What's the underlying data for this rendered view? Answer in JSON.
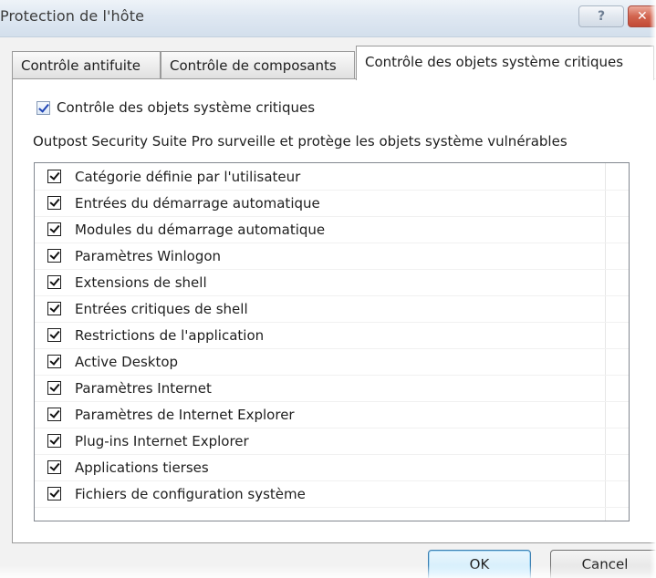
{
  "window": {
    "title": "Protection de l'hôte",
    "help_label": "?",
    "close_label": "✕"
  },
  "tabs": [
    {
      "label": "Contrôle antifuite",
      "selected": false
    },
    {
      "label": "Contrôle de composants",
      "selected": false
    },
    {
      "label": "Contrôle des objets système critiques",
      "selected": true
    }
  ],
  "panel": {
    "main_checkbox": {
      "label": "Contrôle des objets système critiques",
      "checked": true
    },
    "description": "Outpost Security Suite Pro surveille et protège les objets système vulnérables",
    "items": [
      {
        "label": "Catégorie définie par l'utilisateur",
        "checked": true
      },
      {
        "label": "Entrées du démarrage automatique",
        "checked": true
      },
      {
        "label": "Modules du démarrage automatique",
        "checked": true
      },
      {
        "label": "Paramètres Winlogon",
        "checked": true
      },
      {
        "label": "Extensions de shell",
        "checked": true
      },
      {
        "label": "Entrées critiques de shell",
        "checked": true
      },
      {
        "label": "Restrictions de l'application",
        "checked": true
      },
      {
        "label": "Active Desktop",
        "checked": true
      },
      {
        "label": "Paramètres Internet",
        "checked": true
      },
      {
        "label": "Paramètres de Internet Explorer",
        "checked": true
      },
      {
        "label": "Plug-ins Internet Explorer",
        "checked": true
      },
      {
        "label": "Applications tierses",
        "checked": true
      },
      {
        "label": "Fichiers de configuration système",
        "checked": true
      }
    ]
  },
  "buttons": {
    "ok_label": "OK",
    "cancel_label": "Cancel"
  },
  "colors": {
    "title_bar": "#dfe8f2",
    "dialog_face": "#f2f2f2",
    "close_button": "#d2644e",
    "check_accent": "#1f45b5",
    "default_button_border": "#3c7fb1"
  }
}
